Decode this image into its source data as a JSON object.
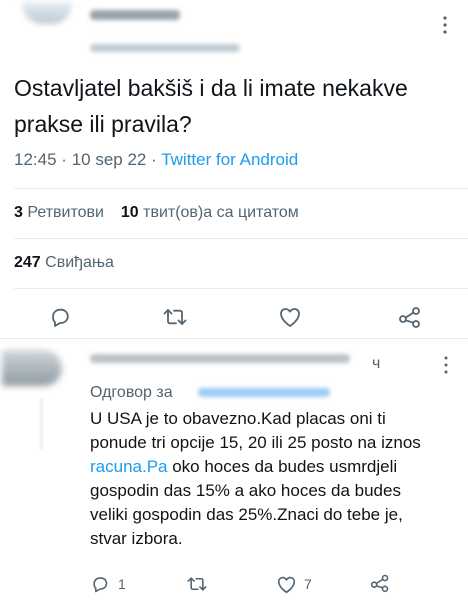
{
  "tweet": {
    "author_name": "",
    "author_handle": "",
    "text": "Ostavljatel bakšiš i da li imate nekakve prakse ili pravila?",
    "time": "12:45",
    "date": "10 sep 22",
    "separator": "·",
    "source": "Twitter for Android"
  },
  "stats": {
    "retweets_count": "3",
    "retweets_label": "Ретвитови",
    "quotes_count": "10",
    "quotes_label": "твит(ов)а са цитатом",
    "likes_count": "247",
    "likes_label": "Свиђања"
  },
  "actions": {
    "icons": [
      "reply-icon",
      "retweet-icon",
      "like-icon",
      "share-icon"
    ]
  },
  "reply": {
    "timestamp": "ч",
    "replying_to_label": "Одговор за",
    "text": "U USA je to obavezno.Kad placas oni ti ponude tri opcije 15, 20 ili 25 posto na iznos ",
    "text_link": "racuna.Pa",
    "text_rest": " oko hoces da budes usmrdjeli gospodin das 15% a ako hoces da budes veliki gospodin das 25%.Znaci do tebe je, stvar izbora.",
    "reply_count": "1",
    "retweet_count": "",
    "like_count": "7"
  },
  "colors": {
    "text": "#0f1419",
    "muted": "#536471",
    "link": "#1d9bf0",
    "divider": "#e6ecf0"
  }
}
